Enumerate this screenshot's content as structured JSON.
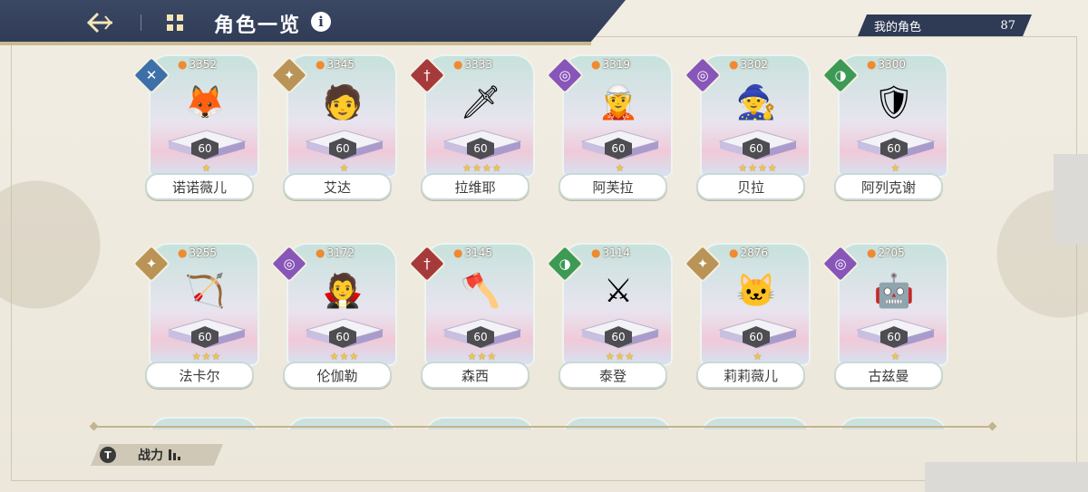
{
  "header": {
    "title": "角色一览",
    "back_icon": "back-arrow-icon",
    "grid_icon": "grid-icon",
    "info_label": "i"
  },
  "counter": {
    "label": "我的角色",
    "value": "87"
  },
  "elements": {
    "wind": {
      "color": "#3d6fa8",
      "glyph": "✕"
    },
    "light": {
      "color": "#b99456",
      "glyph": "✦"
    },
    "fire": {
      "color": "#a63a3a",
      "glyph": "†"
    },
    "dark": {
      "color": "#8855b8",
      "glyph": "◎"
    },
    "earth": {
      "color": "#3c9a54",
      "glyph": "◑"
    }
  },
  "characters": [
    {
      "name": "诺诺薇儿",
      "power": "3352",
      "level": "60",
      "stars": "★",
      "element": "wind",
      "sprite": "🦊"
    },
    {
      "name": "艾达",
      "power": "3345",
      "level": "60",
      "stars": "★",
      "element": "light",
      "sprite": "🧑"
    },
    {
      "name": "拉维耶",
      "power": "3333",
      "level": "60",
      "stars": "★★★★",
      "element": "fire",
      "sprite": "🗡"
    },
    {
      "name": "阿芙拉",
      "power": "3319",
      "level": "60",
      "stars": "★",
      "element": "dark",
      "sprite": "🧝"
    },
    {
      "name": "贝拉",
      "power": "3302",
      "level": "60",
      "stars": "★★★★",
      "element": "dark",
      "sprite": "🧙"
    },
    {
      "name": "阿列克谢",
      "power": "3300",
      "level": "60",
      "stars": "★",
      "element": "earth",
      "sprite": "🛡"
    },
    {
      "name": "法卡尔",
      "power": "3255",
      "level": "60",
      "stars": "★★★",
      "element": "light",
      "sprite": "🏹"
    },
    {
      "name": "伦伽勒",
      "power": "3172",
      "level": "60",
      "stars": "★★★",
      "element": "dark",
      "sprite": "🧛"
    },
    {
      "name": "森西",
      "power": "3145",
      "level": "60",
      "stars": "★★★",
      "element": "fire",
      "sprite": "🪓"
    },
    {
      "name": "泰登",
      "power": "3114",
      "level": "60",
      "stars": "★★★",
      "element": "earth",
      "sprite": "⚔"
    },
    {
      "name": "莉莉薇儿",
      "power": "2876",
      "level": "60",
      "stars": "★",
      "element": "light",
      "sprite": "🐱"
    },
    {
      "name": "古兹曼",
      "power": "2?05",
      "level": "60",
      "stars": "★",
      "element": "dark",
      "sprite": "🤖"
    }
  ],
  "sort": {
    "label": "战力",
    "icon": "filter-icon",
    "glyph": "T"
  }
}
